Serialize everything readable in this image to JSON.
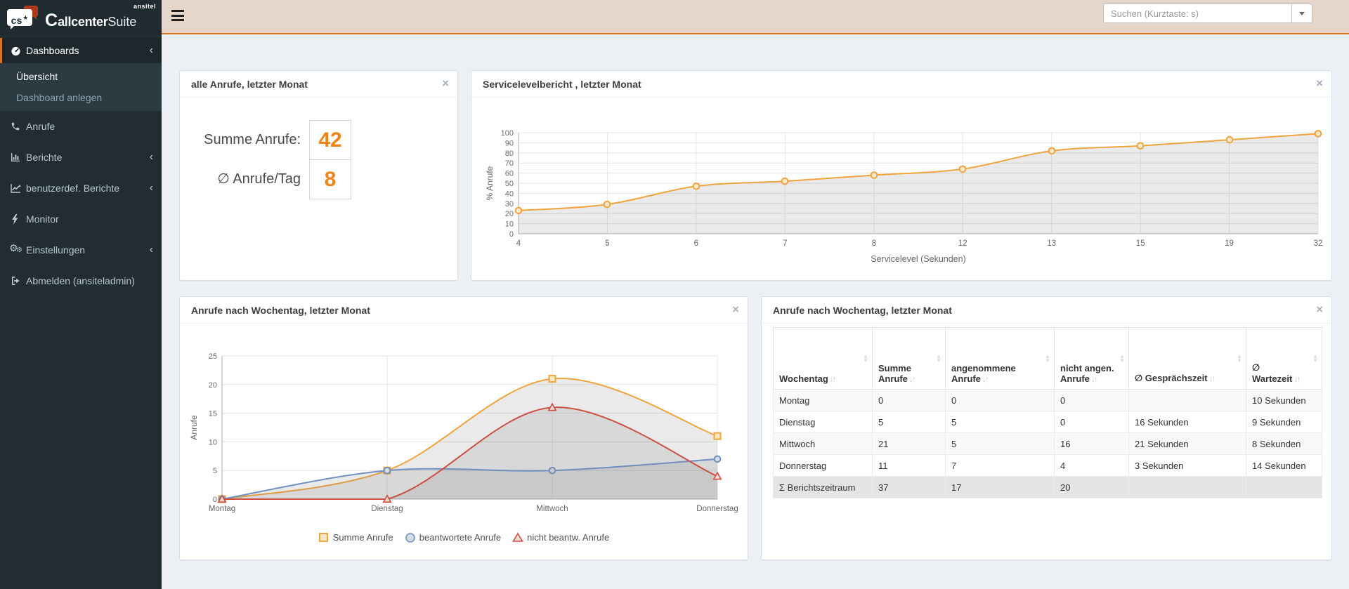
{
  "brand": {
    "tagline": "ansitel",
    "badge": "cs",
    "badge_star": "★",
    "word_c": "C",
    "word_mid": "allcenter",
    "word_light": "Suite"
  },
  "topbar": {
    "search_placeholder": "Suchen (Kurztaste: s)"
  },
  "sidebar": {
    "items": {
      "dashboards": "Dashboards",
      "uebersicht": "Übersicht",
      "anlegen": "Dashboard anlegen",
      "anrufe": "Anrufe",
      "berichte": "Berichte",
      "benutzerdef": "benutzerdef. Berichte",
      "monitor": "Monitor",
      "einstellungen": "Einstellungen",
      "abmelden": "Abmelden (ansiteladmin)"
    }
  },
  "panel_calls": {
    "title": "alle Anrufe, letzter Monat",
    "close_label": "×",
    "row1_label": "Summe Anrufe:",
    "row1_value": "42",
    "row2_label": "∅ Anrufe/Tag",
    "row2_value": "8"
  },
  "chart_data": [
    {
      "type": "line",
      "title": "Servicelevelbericht , letzter Monat",
      "close_label": "×",
      "categories": [
        "4",
        "5",
        "6",
        "7",
        "8",
        "12",
        "13",
        "15",
        "19",
        "32"
      ],
      "series": [
        {
          "name": "% Anrufe",
          "values": [
            23,
            29,
            47,
            52,
            58,
            64,
            82,
            87,
            93,
            99
          ],
          "color": "#f0a43c",
          "marker": "circle",
          "marker_fill": "#f9e9d0"
        }
      ],
      "xlabel": "Servicelevel (Sekunden)",
      "ylabel": "% Anrufe",
      "ylim": [
        0,
        100
      ],
      "ytick_step": 10,
      "grid": true,
      "area": true,
      "legend_position": "none"
    },
    {
      "type": "line",
      "title": "Anrufe nach Wochentag, letzter Monat",
      "close_label": "×",
      "categories": [
        "Montag",
        "Dienstag",
        "Mittwoch",
        "Donnerstag"
      ],
      "series": [
        {
          "name": "Summe Anrufe",
          "values": [
            0,
            5,
            21,
            11
          ],
          "color": "#f0a43c",
          "marker": "square",
          "marker_fill": "#f8e8c9"
        },
        {
          "name": "beantwortete Anrufe",
          "values": [
            0,
            5,
            5,
            7
          ],
          "color": "#7191c4",
          "marker": "circle",
          "marker_fill": "#d7dbe2"
        },
        {
          "name": "nicht beantw. Anrufe",
          "values": [
            0,
            0,
            16,
            4
          ],
          "color": "#cc4f3f",
          "marker": "triangle",
          "marker_fill": "#f7ded3"
        }
      ],
      "xlabel": "",
      "ylabel": "Anrufe",
      "ylim": [
        0,
        25
      ],
      "ytick_step": 5,
      "grid": true,
      "area": true,
      "legend_position": "bottom"
    }
  ],
  "table": {
    "title": "Anrufe nach Wochentag, letzter Monat",
    "close_label": "×",
    "columns": [
      "Wochentag",
      "Summe Anrufe",
      "angenommene Anrufe",
      "nicht angen. Anrufe",
      "∅ Gesprächszeit",
      "∅ Wartezeit"
    ],
    "rows": [
      [
        "Montag",
        "0",
        "0",
        "0",
        "",
        "10 Sekunden"
      ],
      [
        "Dienstag",
        "5",
        "5",
        "0",
        "16 Sekunden",
        "9 Sekunden"
      ],
      [
        "Mittwoch",
        "21",
        "5",
        "16",
        "21 Sekunden",
        "8 Sekunden"
      ],
      [
        "Donnerstag",
        "11",
        "7",
        "4",
        "3 Sekunden",
        "14 Sekunden"
      ],
      [
        "Σ Berichtszeitraum",
        "37",
        "17",
        "20",
        "",
        ""
      ]
    ]
  }
}
